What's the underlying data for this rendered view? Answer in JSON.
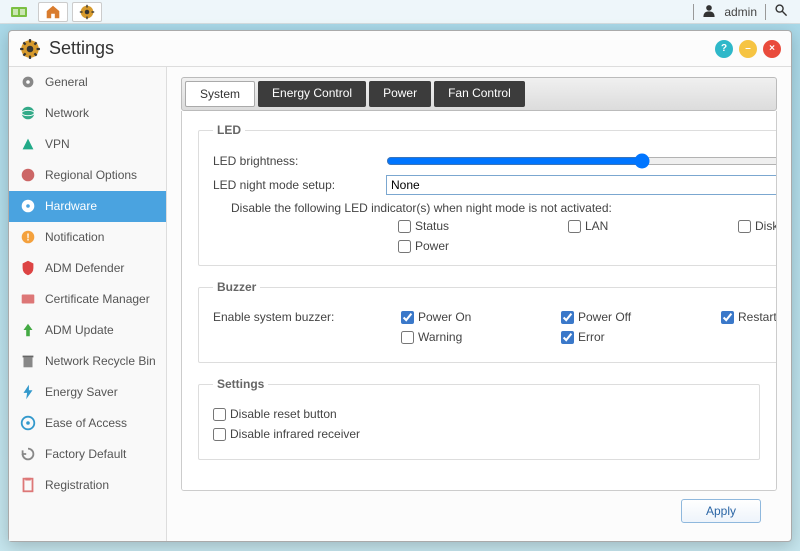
{
  "taskbar": {
    "user_label": "admin"
  },
  "window": {
    "title": "Settings"
  },
  "sidebar": {
    "items": [
      {
        "label": "General"
      },
      {
        "label": "Network"
      },
      {
        "label": "VPN"
      },
      {
        "label": "Regional Options"
      },
      {
        "label": "Hardware"
      },
      {
        "label": "Notification"
      },
      {
        "label": "ADM Defender"
      },
      {
        "label": "Certificate Manager"
      },
      {
        "label": "ADM Update"
      },
      {
        "label": "Network Recycle Bin"
      },
      {
        "label": "Energy Saver"
      },
      {
        "label": "Ease of Access"
      },
      {
        "label": "Factory Default"
      },
      {
        "label": "Registration"
      }
    ]
  },
  "tabs": [
    {
      "label": "System"
    },
    {
      "label": "Energy Control"
    },
    {
      "label": "Power"
    },
    {
      "label": "Fan Control"
    }
  ],
  "led": {
    "legend": "LED",
    "brightness_label": "LED brightness:",
    "night_mode_label": "LED night mode setup:",
    "night_mode_value": "None",
    "disable_note": "Disable the following LED indicator(s) when night mode is not activated:",
    "checks": {
      "status": "Status",
      "lan": "LAN",
      "disk": "Disk",
      "power": "Power"
    }
  },
  "buzzer": {
    "legend": "Buzzer",
    "enable_label": "Enable system buzzer:",
    "checks": {
      "power_on": "Power On",
      "power_off": "Power Off",
      "restart": "Restart",
      "warning": "Warning",
      "error": "Error"
    }
  },
  "settings": {
    "legend": "Settings",
    "disable_reset": "Disable reset button",
    "disable_ir": "Disable infrared receiver"
  },
  "apply_label": "Apply"
}
